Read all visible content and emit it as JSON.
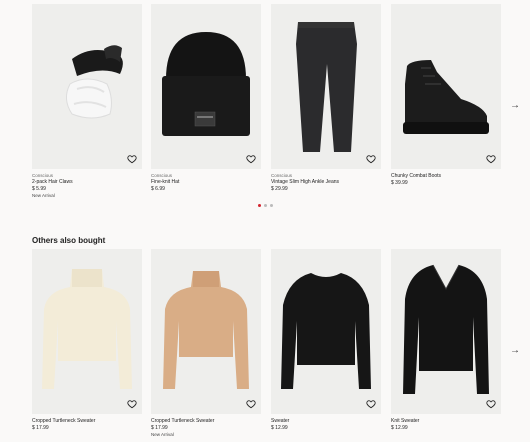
{
  "carousel1": {
    "products": [
      {
        "label": "Conscious",
        "name": "2-pack Hair Claws",
        "price": "$ 5.99",
        "badge": "New Arrival"
      },
      {
        "label": "Conscious",
        "name": "Fine-knit Hat",
        "price": "$ 6.99",
        "badge": ""
      },
      {
        "label": "Conscious",
        "name": "Vintage Slim High Ankle Jeans",
        "price": "$ 29.99",
        "badge": ""
      },
      {
        "label": "",
        "name": "Chunky Combat Boots",
        "price": "$ 39.99",
        "badge": ""
      }
    ],
    "next_icon": "arrow-right-icon",
    "pagination": {
      "count": 3,
      "active": 1
    },
    "accent_color": "#d3252f"
  },
  "carousel2": {
    "heading": "Others also bought",
    "products": [
      {
        "name": "Cropped Turtleneck Sweater",
        "price": "$ 17.99",
        "badge": ""
      },
      {
        "name": "Cropped Turtleneck Sweater",
        "price": "$ 17.99",
        "badge": "New Arrival"
      },
      {
        "name": "Sweater",
        "price": "$ 12.99",
        "badge": ""
      },
      {
        "name": "Knit Sweater",
        "price": "$ 12.99",
        "badge": ""
      }
    ],
    "next_icon": "arrow-right-icon"
  },
  "favorite_icon": "heart-icon"
}
